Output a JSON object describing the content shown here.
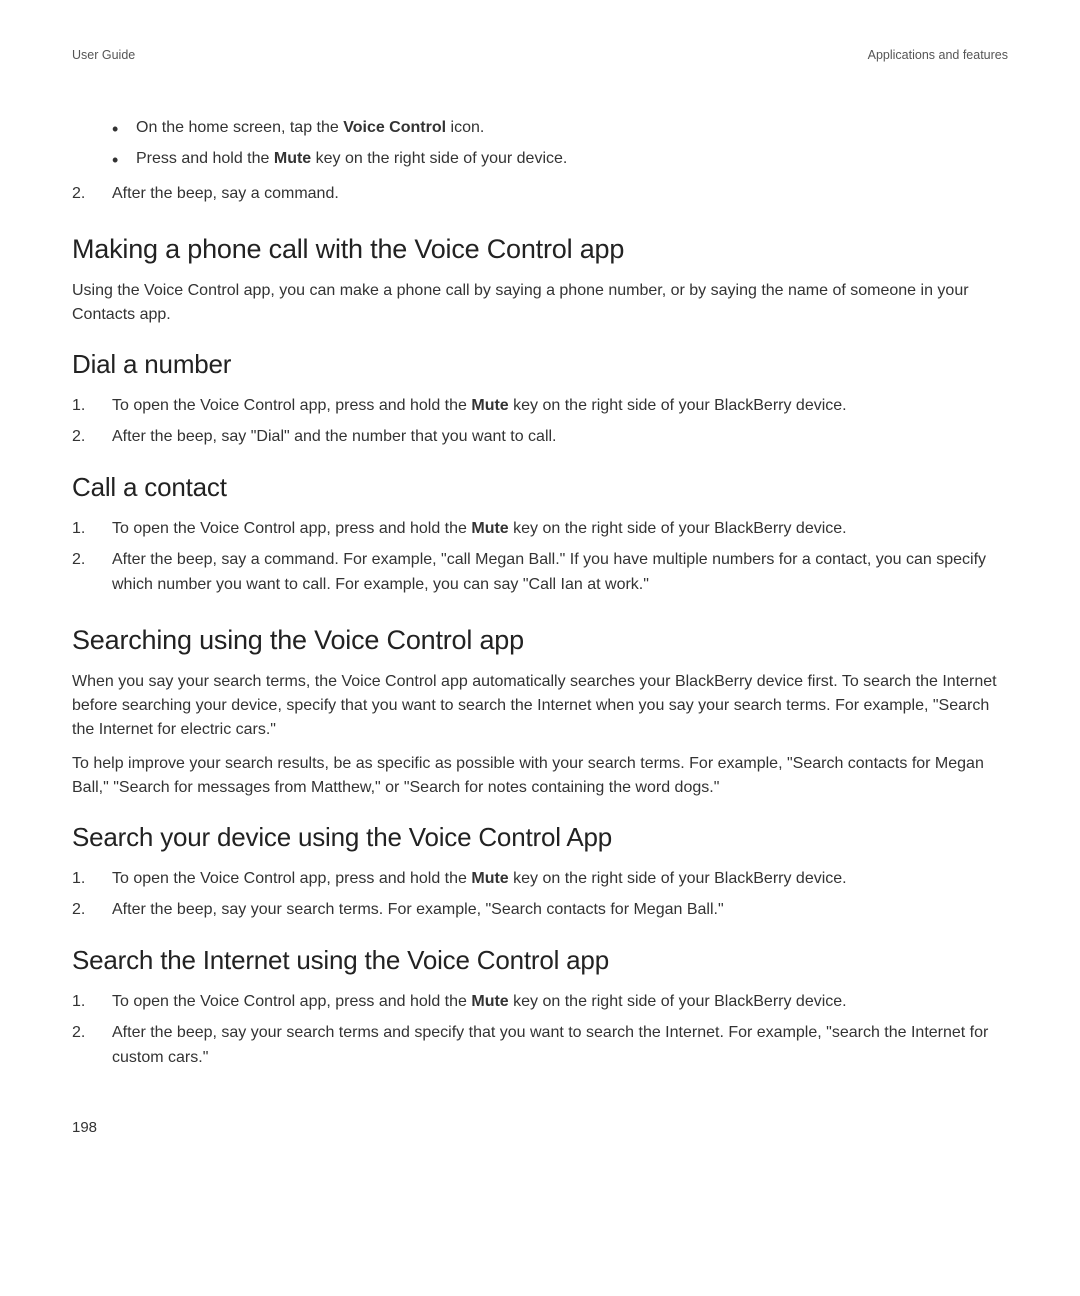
{
  "header": {
    "left": "User Guide",
    "right": "Applications and features"
  },
  "top_bullets": [
    {
      "pre": "On the home screen, tap the ",
      "bold": "Voice Control",
      "post": " icon."
    },
    {
      "pre": "Press and hold the ",
      "bold": "Mute",
      "post": " key on the right side of your device."
    }
  ],
  "top_step2": {
    "num": "2.",
    "text": "After the beep, say a command."
  },
  "sections": {
    "making_call": {
      "title": "Making a phone call with the Voice Control app",
      "para": "Using the Voice Control app, you can make a phone call by saying a phone number, or by saying the name of someone in your Contacts app."
    },
    "dial_number": {
      "title": "Dial a number",
      "steps": [
        {
          "num": "1.",
          "pre": "To open the Voice Control app, press and hold the ",
          "bold": "Mute",
          "post": " key on the right side of your BlackBerry device."
        },
        {
          "num": "2.",
          "text": "After the beep, say \"Dial\" and the number that you want to call."
        }
      ]
    },
    "call_contact": {
      "title": "Call a contact",
      "steps": [
        {
          "num": "1.",
          "pre": "To open the Voice Control app, press and hold the ",
          "bold": "Mute",
          "post": " key on the right side of your BlackBerry device."
        },
        {
          "num": "2.",
          "text": "After the beep, say a command. For example, \"call Megan Ball.\" If you have multiple numbers for a contact, you can specify which number you want to call. For example, you can say \"Call Ian at work.\""
        }
      ]
    },
    "searching": {
      "title": "Searching using the Voice Control app",
      "para1": "When you say your search terms, the Voice Control app automatically searches your BlackBerry device first. To search the Internet before searching your device, specify that you want to search the Internet when you say your search terms. For example, \"Search the Internet for electric cars.\"",
      "para2": "To help improve your search results, be as specific as possible with your search terms. For example, \"Search contacts for Megan Ball,\" \"Search for messages from Matthew,\" or \"Search for notes containing the word dogs.\""
    },
    "search_device": {
      "title": "Search your device using the Voice Control App",
      "steps": [
        {
          "num": "1.",
          "pre": "To open the Voice Control app, press and hold the ",
          "bold": "Mute",
          "post": " key on the right side of your BlackBerry device."
        },
        {
          "num": "2.",
          "text": "After the beep, say your search terms. For example, \"Search contacts for Megan Ball.\""
        }
      ]
    },
    "search_internet": {
      "title": "Search the Internet using the Voice Control app",
      "steps": [
        {
          "num": "1.",
          "pre": "To open the Voice Control app, press and hold the ",
          "bold": "Mute",
          "post": " key on the right side of your BlackBerry device."
        },
        {
          "num": "2.",
          "text": "After the beep, say your search terms and specify that you want to search the Internet. For example, \"search the Internet for custom cars.\""
        }
      ]
    }
  },
  "page_number": "198"
}
